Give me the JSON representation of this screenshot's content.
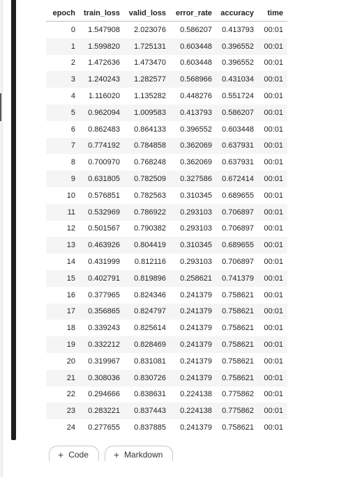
{
  "table": {
    "columns": [
      "epoch",
      "train_loss",
      "valid_loss",
      "error_rate",
      "accuracy",
      "time"
    ],
    "rows": [
      [
        "0",
        "1.547908",
        "2.023076",
        "0.586207",
        "0.413793",
        "00:01"
      ],
      [
        "1",
        "1.599820",
        "1.725131",
        "0.603448",
        "0.396552",
        "00:01"
      ],
      [
        "2",
        "1.472636",
        "1.473470",
        "0.603448",
        "0.396552",
        "00:01"
      ],
      [
        "3",
        "1.240243",
        "1.282577",
        "0.568966",
        "0.431034",
        "00:01"
      ],
      [
        "4",
        "1.116020",
        "1.135282",
        "0.448276",
        "0.551724",
        "00:01"
      ],
      [
        "5",
        "0.962094",
        "1.009583",
        "0.413793",
        "0.586207",
        "00:01"
      ],
      [
        "6",
        "0.862483",
        "0.864133",
        "0.396552",
        "0.603448",
        "00:01"
      ],
      [
        "7",
        "0.774192",
        "0.784858",
        "0.362069",
        "0.637931",
        "00:01"
      ],
      [
        "8",
        "0.700970",
        "0.768248",
        "0.362069",
        "0.637931",
        "00:01"
      ],
      [
        "9",
        "0.631805",
        "0.782509",
        "0.327586",
        "0.672414",
        "00:01"
      ],
      [
        "10",
        "0.576851",
        "0.782563",
        "0.310345",
        "0.689655",
        "00:01"
      ],
      [
        "11",
        "0.532969",
        "0.786922",
        "0.293103",
        "0.706897",
        "00:01"
      ],
      [
        "12",
        "0.501567",
        "0.790382",
        "0.293103",
        "0.706897",
        "00:01"
      ],
      [
        "13",
        "0.463926",
        "0.804419",
        "0.310345",
        "0.689655",
        "00:01"
      ],
      [
        "14",
        "0.431999",
        "0.812116",
        "0.293103",
        "0.706897",
        "00:01"
      ],
      [
        "15",
        "0.402791",
        "0.819896",
        "0.258621",
        "0.741379",
        "00:01"
      ],
      [
        "16",
        "0.377965",
        "0.824346",
        "0.241379",
        "0.758621",
        "00:01"
      ],
      [
        "17",
        "0.356865",
        "0.824797",
        "0.241379",
        "0.758621",
        "00:01"
      ],
      [
        "18",
        "0.339243",
        "0.825614",
        "0.241379",
        "0.758621",
        "00:01"
      ],
      [
        "19",
        "0.332212",
        "0.828469",
        "0.241379",
        "0.758621",
        "00:01"
      ],
      [
        "20",
        "0.319967",
        "0.831081",
        "0.241379",
        "0.758621",
        "00:01"
      ],
      [
        "21",
        "0.308036",
        "0.830726",
        "0.241379",
        "0.758621",
        "00:01"
      ],
      [
        "22",
        "0.294666",
        "0.838631",
        "0.224138",
        "0.775862",
        "00:01"
      ],
      [
        "23",
        "0.283221",
        "0.837443",
        "0.224138",
        "0.775862",
        "00:01"
      ],
      [
        "24",
        "0.277655",
        "0.837885",
        "0.241379",
        "0.758621",
        "00:01"
      ]
    ]
  },
  "add_cell": {
    "code_label": "Code",
    "markdown_label": "Markdown",
    "icon": "plus-icon"
  },
  "colors": {
    "cell_bar": "#1f1f1f",
    "row_stripe": "#f5f5f5",
    "header_border": "#bdbdbd"
  }
}
